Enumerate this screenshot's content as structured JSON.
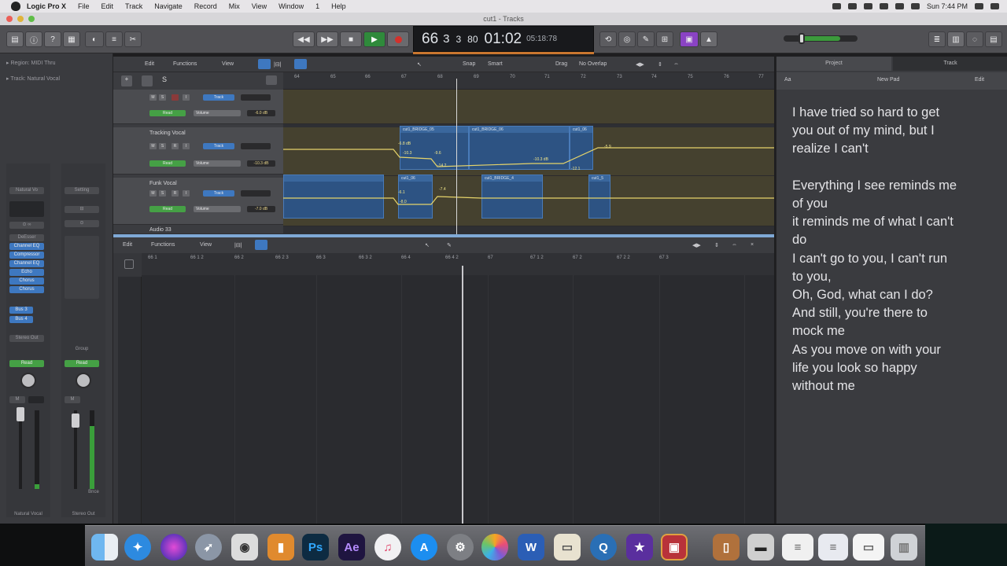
{
  "menubar": {
    "items": [
      "Logic Pro X",
      "File",
      "Edit",
      "Track",
      "Navigate",
      "Record",
      "Mix",
      "View",
      "Window",
      "1",
      "Help"
    ],
    "clock": "Sun 7:44 PM"
  },
  "window_title": "cut1 - Tracks",
  "lcd": {
    "bar": "66",
    "beat": "3",
    "division": "3",
    "tick": "80",
    "time": "01:02",
    "frames": "05:18:78"
  },
  "inspector": {
    "region_label": "▸ Region: MIDI Thru",
    "track_label": "▸ Track: Natural Vocal",
    "strip1": {
      "setting": "Natural Vo",
      "plugins": [
        "DeEsser",
        "Channel EQ",
        "Compressor",
        "Channel EQ",
        "Echo",
        "Chorus",
        "Chorus"
      ],
      "sends": [
        "Bus 3",
        "Bus 4"
      ],
      "output": "Stereo Out",
      "read": "Read",
      "name": "Natural Vocal"
    },
    "strip2": {
      "setting": "Setting",
      "group": "Group",
      "read": "Read",
      "bounce": "Bnce",
      "name": "Stereo Out"
    }
  },
  "tracks_header": {
    "menus": [
      "Edit",
      "Functions",
      "View"
    ],
    "snap_label": "Snap",
    "snap_value": "Smart",
    "drag_label": "Drag",
    "drag_value": "No Overlap"
  },
  "ruler_top": [
    "64",
    "65",
    "66",
    "67",
    "68",
    "69",
    "70",
    "71",
    "72",
    "73",
    "74",
    "75",
    "76",
    "77"
  ],
  "tracks": [
    {
      "name": "",
      "mode": "Track",
      "automation": "Read",
      "param": "Volume",
      "value": "-6.0 dB"
    },
    {
      "name": "Tracking Vocal",
      "mode": "Track",
      "automation": "Read",
      "param": "Volume",
      "value": "-10.3 dB"
    },
    {
      "name": "Funk Vocal",
      "mode": "Track",
      "automation": "Read",
      "param": "Volume",
      "value": "-7.0 dB"
    },
    {
      "name": "Audio 33",
      "mode": "",
      "automation": "",
      "param": "",
      "value": ""
    }
  ],
  "regions": {
    "r1": "cut1_BRIDGE_05",
    "r2": "cut1_BRIDGE_06",
    "r3": "cut1_06",
    "r4": "",
    "r5": "cut1_06",
    "r6": "cut1_BRIDGE_4",
    "r7": "cut1_5"
  },
  "automation_values": [
    "-6.8 dB",
    "-10.3",
    "-14.2",
    "-9.6",
    "-10.3 dB",
    "-12.1",
    "-5.9",
    "-6.1",
    "-8.0",
    "-7.4"
  ],
  "editor_header": {
    "menus": [
      "Edit",
      "Functions",
      "View"
    ]
  },
  "editor_ruler": [
    "66 1",
    "66 1 2",
    "66 2",
    "66 2 3",
    "66 3",
    "66 3 2",
    "66 4",
    "66 4 2",
    "67",
    "67 1 2",
    "67 2",
    "67 2 2",
    "67 3"
  ],
  "right_panel": {
    "tabs": [
      "Project",
      "Track"
    ],
    "toolbar": {
      "font": "Aa",
      "title": "New Pad",
      "edit": "Edit"
    },
    "lyrics": [
      "I have tried so hard to get",
      "you out of my mind, but I",
      "realize I can't",
      "",
      "Everything I see reminds me",
      "of you",
      "it reminds me of what I can't",
      "do",
      "I can't go to you, I can't run",
      "to you,",
      "Oh, God, what can I do?",
      "And still, you're there to",
      "mock me",
      "As you move on with your",
      "life you look so happy",
      "without me"
    ]
  },
  "dock": {
    "icons": [
      "finder",
      "safari",
      "siri",
      "launchpad",
      "vectorworks",
      "ibooks",
      "Ps",
      "Ae",
      "itunes",
      "appstore",
      "system-prefs",
      "photos",
      "word",
      "preview",
      "quicktime",
      "imovie",
      "photobooth",
      "contacts",
      "terminal",
      "document",
      "document",
      "document",
      "trash"
    ],
    "ps_label": "Ps",
    "ae_label": "Ae"
  }
}
